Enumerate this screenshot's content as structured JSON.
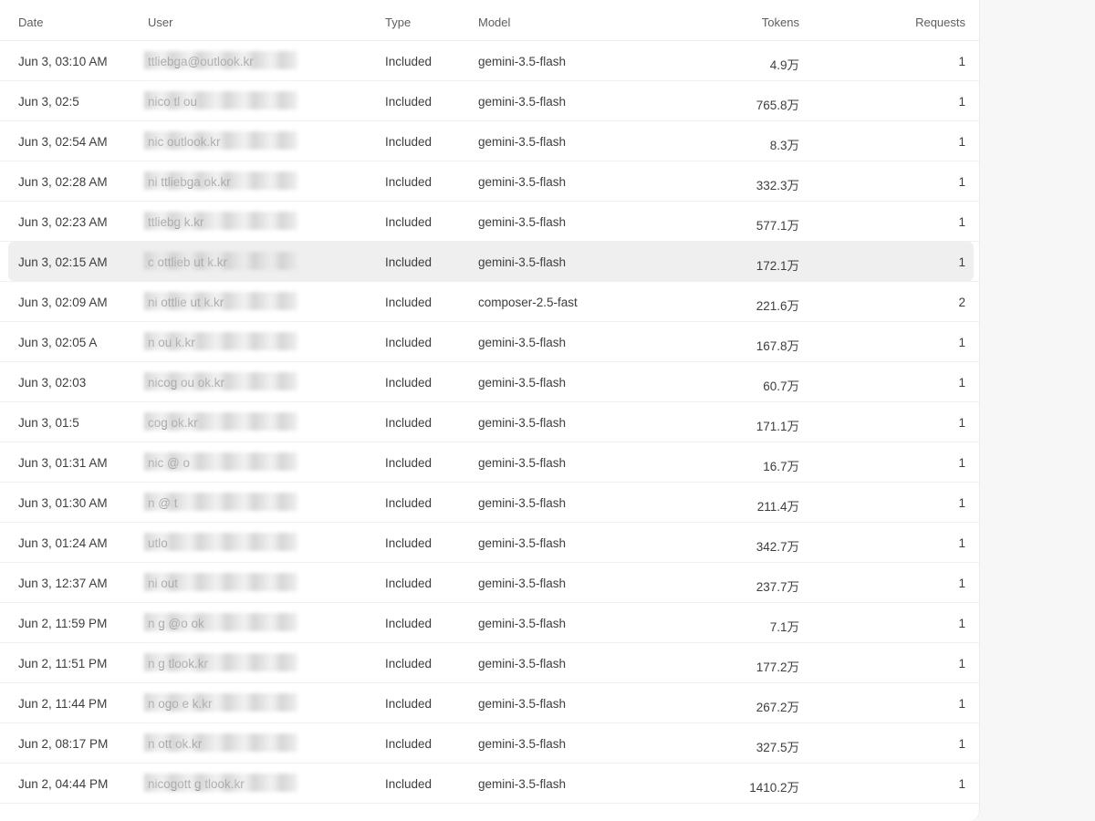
{
  "columns": {
    "date": "Date",
    "user": "User",
    "type": "Type",
    "model": "Model",
    "tokens": "Tokens",
    "requests": "Requests"
  },
  "rows": [
    {
      "date": "Jun 3, 03:10 AM",
      "user": "ttliebga@outlook.kr",
      "type": "Included",
      "model": "gemini-3.5-flash",
      "tokens": "4.9万",
      "requests": "1"
    },
    {
      "date": "Jun 3, 02:5",
      "user": "nico tl ou",
      "type": "Included",
      "model": "gemini-3.5-flash",
      "tokens": "765.8万",
      "requests": "1"
    },
    {
      "date": "Jun 3, 02:54 AM",
      "user": "nic outlook.kr",
      "type": "Included",
      "model": "gemini-3.5-flash",
      "tokens": "8.3万",
      "requests": "1"
    },
    {
      "date": "Jun 3, 02:28 AM",
      "user": "ni ttliebga ok.kr",
      "type": "Included",
      "model": "gemini-3.5-flash",
      "tokens": "332.3万",
      "requests": "1"
    },
    {
      "date": "Jun 3, 02:23 AM",
      "user": "ttliebg k.kr",
      "type": "Included",
      "model": "gemini-3.5-flash",
      "tokens": "577.1万",
      "requests": "1"
    },
    {
      "date": "Jun 3, 02:15 AM",
      "user": "c ottlieb ut k.kr",
      "type": "Included",
      "model": "gemini-3.5-flash",
      "tokens": "172.1万",
      "requests": "1"
    },
    {
      "date": "Jun 3, 02:09 AM",
      "user": "ni ottlie ut k.kr",
      "type": "Included",
      "model": "composer-2.5-fast",
      "tokens": "221.6万",
      "requests": "2"
    },
    {
      "date": "Jun 3, 02:05 A",
      "user": "n ou k.kr",
      "type": "Included",
      "model": "gemini-3.5-flash",
      "tokens": "167.8万",
      "requests": "1"
    },
    {
      "date": "Jun 3, 02:03",
      "user": "nicog ou ok.kr",
      "type": "Included",
      "model": "gemini-3.5-flash",
      "tokens": "60.7万",
      "requests": "1"
    },
    {
      "date": "Jun 3, 01:5",
      "user": "cog ok.kr",
      "type": "Included",
      "model": "gemini-3.5-flash",
      "tokens": "171.1万",
      "requests": "1"
    },
    {
      "date": "Jun 3, 01:31 AM",
      "user": "nic @ o",
      "type": "Included",
      "model": "gemini-3.5-flash",
      "tokens": "16.7万",
      "requests": "1"
    },
    {
      "date": "Jun 3, 01:30 AM",
      "user": "n @ t",
      "type": "Included",
      "model": "gemini-3.5-flash",
      "tokens": "211.4万",
      "requests": "1"
    },
    {
      "date": "Jun 3, 01:24 AM",
      "user": "utlo",
      "type": "Included",
      "model": "gemini-3.5-flash",
      "tokens": "342.7万",
      "requests": "1"
    },
    {
      "date": "Jun 3, 12:37 AM",
      "user": "ni out",
      "type": "Included",
      "model": "gemini-3.5-flash",
      "tokens": "237.7万",
      "requests": "1"
    },
    {
      "date": "Jun 2, 11:59 PM",
      "user": "n g @o ok",
      "type": "Included",
      "model": "gemini-3.5-flash",
      "tokens": "7.1万",
      "requests": "1"
    },
    {
      "date": "Jun 2, 11:51 PM",
      "user": "n g tlook.kr",
      "type": "Included",
      "model": "gemini-3.5-flash",
      "tokens": "177.2万",
      "requests": "1"
    },
    {
      "date": "Jun 2, 11:44 PM",
      "user": "n ogo e k.kr",
      "type": "Included",
      "model": "gemini-3.5-flash",
      "tokens": "267.2万",
      "requests": "1"
    },
    {
      "date": "Jun 2, 08:17 PM",
      "user": "n ott ok.kr",
      "type": "Included",
      "model": "gemini-3.5-flash",
      "tokens": "327.5万",
      "requests": "1"
    },
    {
      "date": "Jun 2, 04:44 PM",
      "user": "nicogott g tlook.kr",
      "type": "Included",
      "model": "gemini-3.5-flash",
      "tokens": "1410.2万",
      "requests": "1"
    }
  ],
  "highlighted_row": 5
}
